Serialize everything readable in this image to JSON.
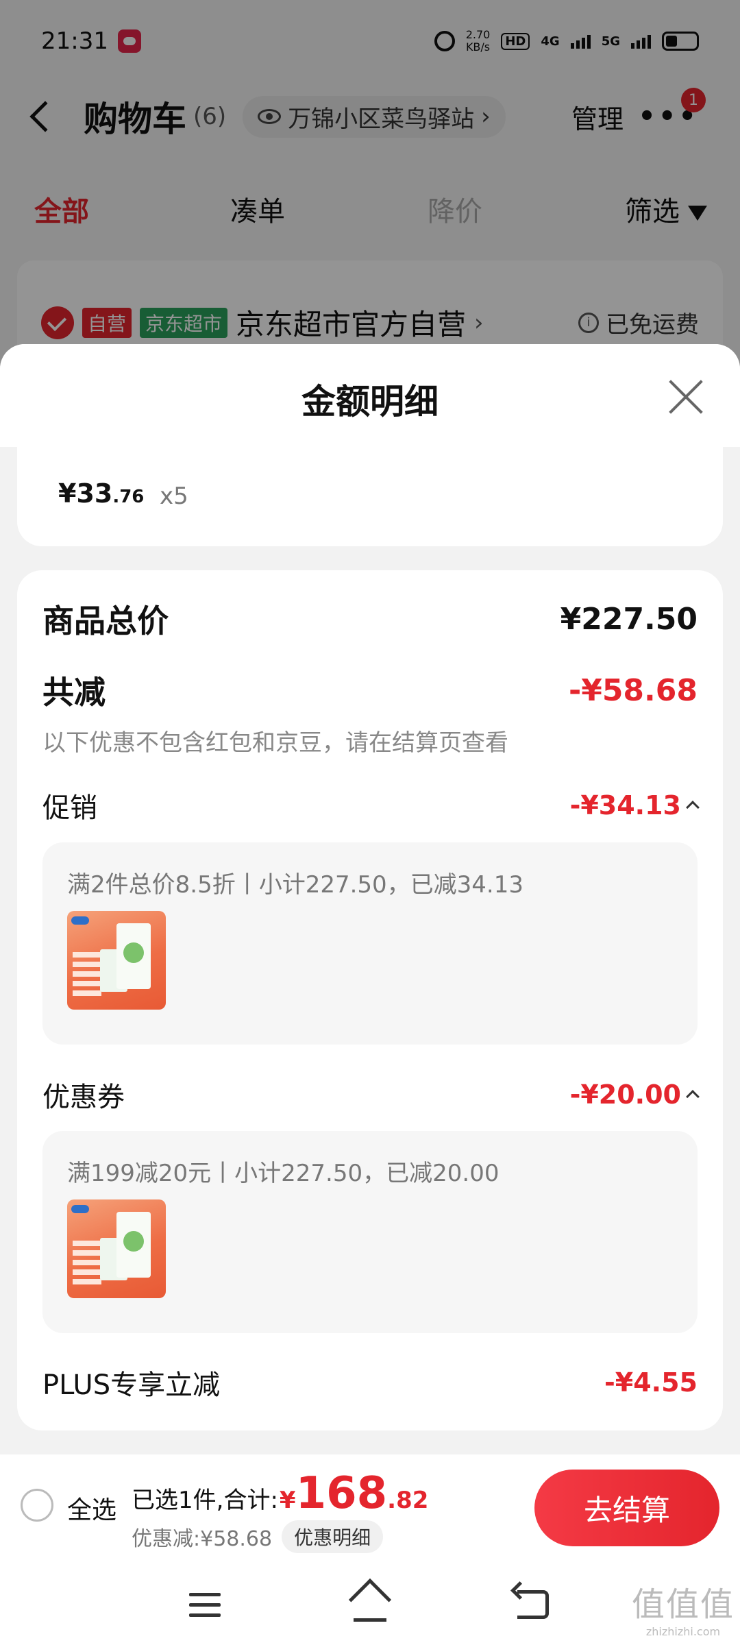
{
  "status_bar": {
    "time": "21:31",
    "net_speed_value": "2.70",
    "net_speed_unit": "KB/s",
    "hd_label": "HD",
    "signal1": "4G",
    "signal2": "5G"
  },
  "header": {
    "title": "购物车",
    "count": "(6)",
    "address": "万锦小区菜鸟驿站",
    "manage_label": "管理",
    "notification_badge": "1"
  },
  "tabs": [
    {
      "label": "全部",
      "state": "active"
    },
    {
      "label": "凑单",
      "state": "normal"
    },
    {
      "label": "降价",
      "state": "disabled"
    },
    {
      "label": "筛选",
      "state": "normal"
    }
  ],
  "store": {
    "tag_self": "自营",
    "tag_supermarket": "京东超市",
    "name": "京东超市官方自营",
    "shipping": "已免运费"
  },
  "sheet": {
    "title": "金额明细",
    "item": {
      "price_int": "¥33",
      "price_dec": ".76",
      "qty": "x5"
    },
    "total_label": "商品总价",
    "total_value": "¥227.50",
    "reduce_label": "共减",
    "reduce_value": "-¥58.68",
    "reduce_note": "以下优惠不包含红包和京豆，请在结算页查看",
    "promo": {
      "label": "促销",
      "value": "-¥34.13",
      "rule": "满2件总价8.5折丨小计227.50，已减34.13"
    },
    "coupon": {
      "label": "优惠券",
      "value": "-¥20.00",
      "rule": "满199减20元丨小计227.50，已减20.00"
    },
    "plus": {
      "label": "PLUS专享立减",
      "value": "-¥4.55"
    }
  },
  "bottom_bar": {
    "select_all": "全选",
    "selected_prefix": "已选1件,合计:",
    "currency": "¥",
    "total_int": "168",
    "total_dec": ".82",
    "discount_label": "优惠减:¥58.68",
    "detail_chip": "优惠明细",
    "checkout": "去结算"
  },
  "watermark": {
    "glyphs": "值值值",
    "url": "zhizhizhi.com"
  },
  "colors": {
    "accent_red": "#e4252d",
    "green_tag": "#2aa15c",
    "overlay": "rgba(0,0,0,0.42)"
  },
  "icons": [
    "back-chevron-icon",
    "eye-icon",
    "more-icon",
    "filter-icon",
    "check-icon",
    "info-icon",
    "close-icon",
    "chevron-up-icon",
    "menu-icon",
    "home-icon",
    "back-icon"
  ]
}
